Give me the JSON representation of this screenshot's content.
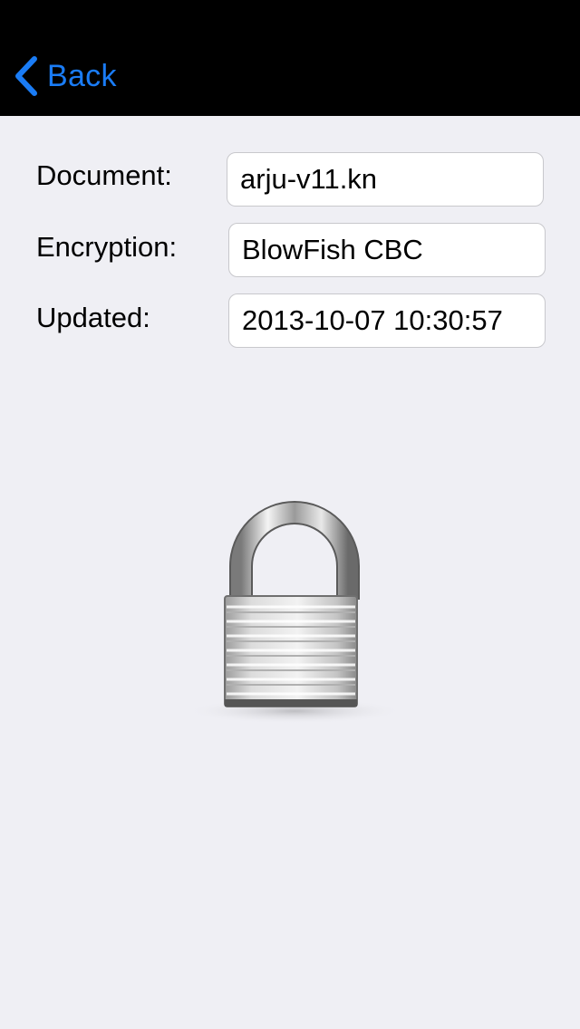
{
  "nav": {
    "back_label": "Back"
  },
  "details": {
    "document_label": "Document:",
    "document_value": "arju-v11.kn",
    "encryption_label": "Encryption:",
    "encryption_value": "BlowFish CBC",
    "updated_label": "Updated:",
    "updated_value": "2013-10-07 10:30:57"
  },
  "icons": {
    "back": "chevron-left-icon",
    "lock": "padlock-icon"
  },
  "colors": {
    "nav_background": "#000000",
    "accent": "#1a7cf5",
    "page_background": "#efeff4"
  }
}
